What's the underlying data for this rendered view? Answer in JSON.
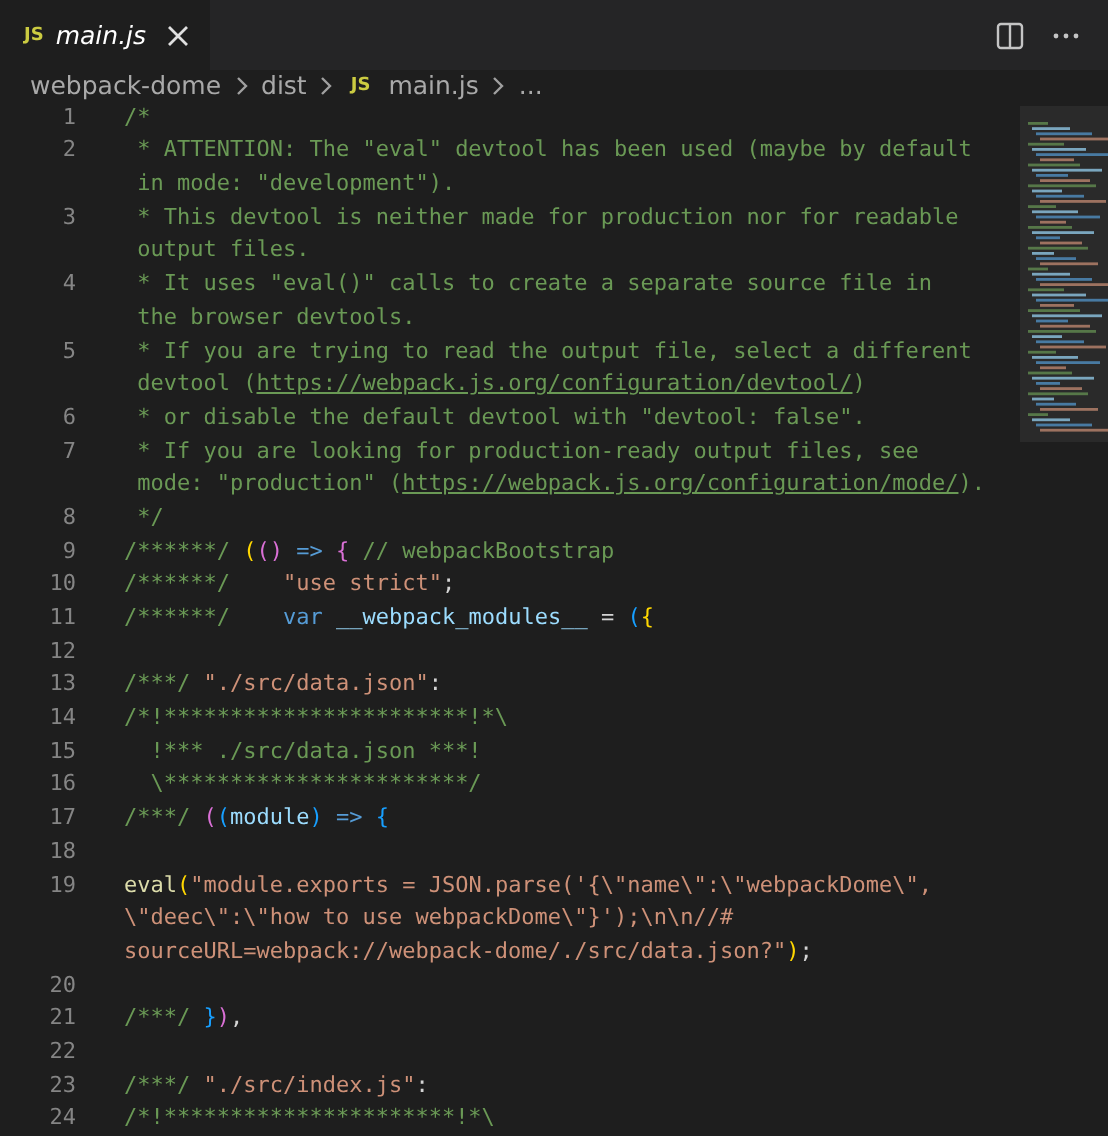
{
  "tab": {
    "icon_text": "JS",
    "label": "main.js",
    "selected": true,
    "preview": true
  },
  "breadcrumb": [
    {
      "label": "webpack-dome"
    },
    {
      "label": "dist"
    },
    {
      "label": "main.js",
      "icon_text": "JS"
    },
    {
      "label": "..."
    }
  ],
  "lines": [
    {
      "number": "1",
      "rows": [
        {
          "tokens": [
            {
              "kind": "comment",
              "text": "/*"
            }
          ]
        }
      ]
    },
    {
      "number": "2",
      "rows": [
        {
          "tokens": [
            {
              "kind": "comment",
              "text": " * ATTENTION: The \"eval\" devtool has been used (maybe by default"
            }
          ]
        },
        {
          "tokens": [
            {
              "kind": "comment",
              "text": " in mode: \"development\")."
            }
          ]
        }
      ]
    },
    {
      "number": "3",
      "rows": [
        {
          "tokens": [
            {
              "kind": "comment",
              "text": " * This devtool is neither made for production nor for readable"
            }
          ]
        },
        {
          "tokens": [
            {
              "kind": "comment",
              "text": " output files."
            }
          ]
        }
      ]
    },
    {
      "number": "4",
      "rows": [
        {
          "tokens": [
            {
              "kind": "comment",
              "text": " * It uses \"eval()\" calls to create a separate source file in"
            }
          ]
        },
        {
          "tokens": [
            {
              "kind": "comment",
              "text": " the browser devtools."
            }
          ]
        }
      ]
    },
    {
      "number": "5",
      "rows": [
        {
          "tokens": [
            {
              "kind": "comment",
              "text": " * If you are trying to read the output file, select a different"
            }
          ]
        },
        {
          "tokens": [
            {
              "kind": "comment",
              "text": " devtool ("
            },
            {
              "kind": "link",
              "text": "https://webpack.js.org/configuration/devtool/"
            },
            {
              "kind": "comment",
              "text": ")"
            }
          ]
        }
      ]
    },
    {
      "number": "6",
      "rows": [
        {
          "tokens": [
            {
              "kind": "comment",
              "text": " * or disable the default devtool with \"devtool: false\"."
            }
          ]
        }
      ]
    },
    {
      "number": "7",
      "rows": [
        {
          "tokens": [
            {
              "kind": "comment",
              "text": " * If you are looking for production-ready output files, see"
            }
          ]
        },
        {
          "tokens": [
            {
              "kind": "comment",
              "text": " mode: \"production\" ("
            },
            {
              "kind": "link",
              "text": "https://webpack.js.org/configuration/mode/"
            },
            {
              "kind": "comment",
              "text": ")."
            }
          ]
        }
      ]
    },
    {
      "number": "8",
      "rows": [
        {
          "tokens": [
            {
              "kind": "comment",
              "text": " */"
            }
          ]
        }
      ]
    },
    {
      "number": "9",
      "rows": [
        {
          "tokens": [
            {
              "kind": "comment",
              "text": "/******/"
            },
            {
              "kind": "bracket1",
              "text": " ("
            },
            {
              "kind": "bracket2",
              "text": "()"
            },
            {
              "kind": "keyword",
              "text": " => "
            },
            {
              "kind": "bracket2",
              "text": "{"
            },
            {
              "kind": "comment",
              "text": " // webpackBootstrap"
            }
          ]
        }
      ]
    },
    {
      "number": "10",
      "rows": [
        {
          "tokens": [
            {
              "kind": "comment",
              "text": "/******/"
            },
            {
              "kind": "string",
              "text": " \t\"use strict\""
            },
            {
              "kind": "plain",
              "text": ";"
            }
          ]
        }
      ]
    },
    {
      "number": "11",
      "rows": [
        {
          "tokens": [
            {
              "kind": "comment",
              "text": "/******/"
            },
            {
              "kind": "keyword",
              "text": " \tvar "
            },
            {
              "kind": "variable",
              "text": "__webpack_modules__"
            },
            {
              "kind": "plain",
              "text": " = "
            },
            {
              "kind": "bracket3",
              "text": "("
            },
            {
              "kind": "bracket1",
              "text": "{"
            }
          ]
        }
      ]
    },
    {
      "number": "12",
      "rows": [
        {
          "tokens": []
        }
      ]
    },
    {
      "number": "13",
      "rows": [
        {
          "tokens": [
            {
              "kind": "comment",
              "text": "/***/"
            },
            {
              "kind": "string",
              "text": " \"./src/data.json\""
            },
            {
              "kind": "plain",
              "text": ":"
            }
          ]
        }
      ]
    },
    {
      "number": "14",
      "rows": [
        {
          "tokens": [
            {
              "kind": "comment",
              "text": "/*!***********************!*\\"
            }
          ]
        }
      ]
    },
    {
      "number": "15",
      "rows": [
        {
          "tokens": [
            {
              "kind": "comment",
              "text": "  !*** ./src/data.json ***!"
            }
          ]
        }
      ]
    },
    {
      "number": "16",
      "rows": [
        {
          "tokens": [
            {
              "kind": "comment",
              "text": "  \\***********************/"
            }
          ]
        }
      ]
    },
    {
      "number": "17",
      "rows": [
        {
          "tokens": [
            {
              "kind": "comment",
              "text": "/***/"
            },
            {
              "kind": "bracket2",
              "text": " ("
            },
            {
              "kind": "bracket3",
              "text": "("
            },
            {
              "kind": "variable",
              "text": "module"
            },
            {
              "kind": "bracket3",
              "text": ")"
            },
            {
              "kind": "keyword",
              "text": " => "
            },
            {
              "kind": "bracket3",
              "text": "{"
            }
          ]
        }
      ]
    },
    {
      "number": "18",
      "rows": [
        {
          "tokens": []
        }
      ]
    },
    {
      "number": "19",
      "rows": [
        {
          "tokens": [
            {
              "kind": "function",
              "text": "eval"
            },
            {
              "kind": "bracket1",
              "text": "("
            },
            {
              "kind": "string",
              "text": "\"module.exports = JSON.parse('{\\\"name\\\":\\\"webpackDome\\\","
            }
          ]
        },
        {
          "tokens": [
            {
              "kind": "string",
              "text": "\\\"deec\\\":\\\"how to use webpackDome\\\"}');\\n\\n//#"
            }
          ]
        },
        {
          "tokens": [
            {
              "kind": "string",
              "text": "sourceURL=webpack://webpack-dome/./src/data.json?\""
            },
            {
              "kind": "bracket1",
              "text": ")"
            },
            {
              "kind": "plain",
              "text": ";"
            }
          ]
        }
      ]
    },
    {
      "number": "20",
      "rows": [
        {
          "tokens": []
        }
      ]
    },
    {
      "number": "21",
      "rows": [
        {
          "tokens": [
            {
              "kind": "comment",
              "text": "/***/"
            },
            {
              "kind": "bracket3",
              "text": " }"
            },
            {
              "kind": "bracket2",
              "text": ")"
            },
            {
              "kind": "plain",
              "text": ","
            }
          ]
        }
      ]
    },
    {
      "number": "22",
      "rows": [
        {
          "tokens": []
        }
      ]
    },
    {
      "number": "23",
      "rows": [
        {
          "tokens": [
            {
              "kind": "comment",
              "text": "/***/"
            },
            {
              "kind": "string",
              "text": " \"./src/index.js\""
            },
            {
              "kind": "plain",
              "text": ":"
            }
          ]
        }
      ]
    },
    {
      "number": "24",
      "rows": [
        {
          "tokens": [
            {
              "kind": "comment",
              "text": "/*!**********************!*\\"
            }
          ]
        }
      ]
    }
  ]
}
